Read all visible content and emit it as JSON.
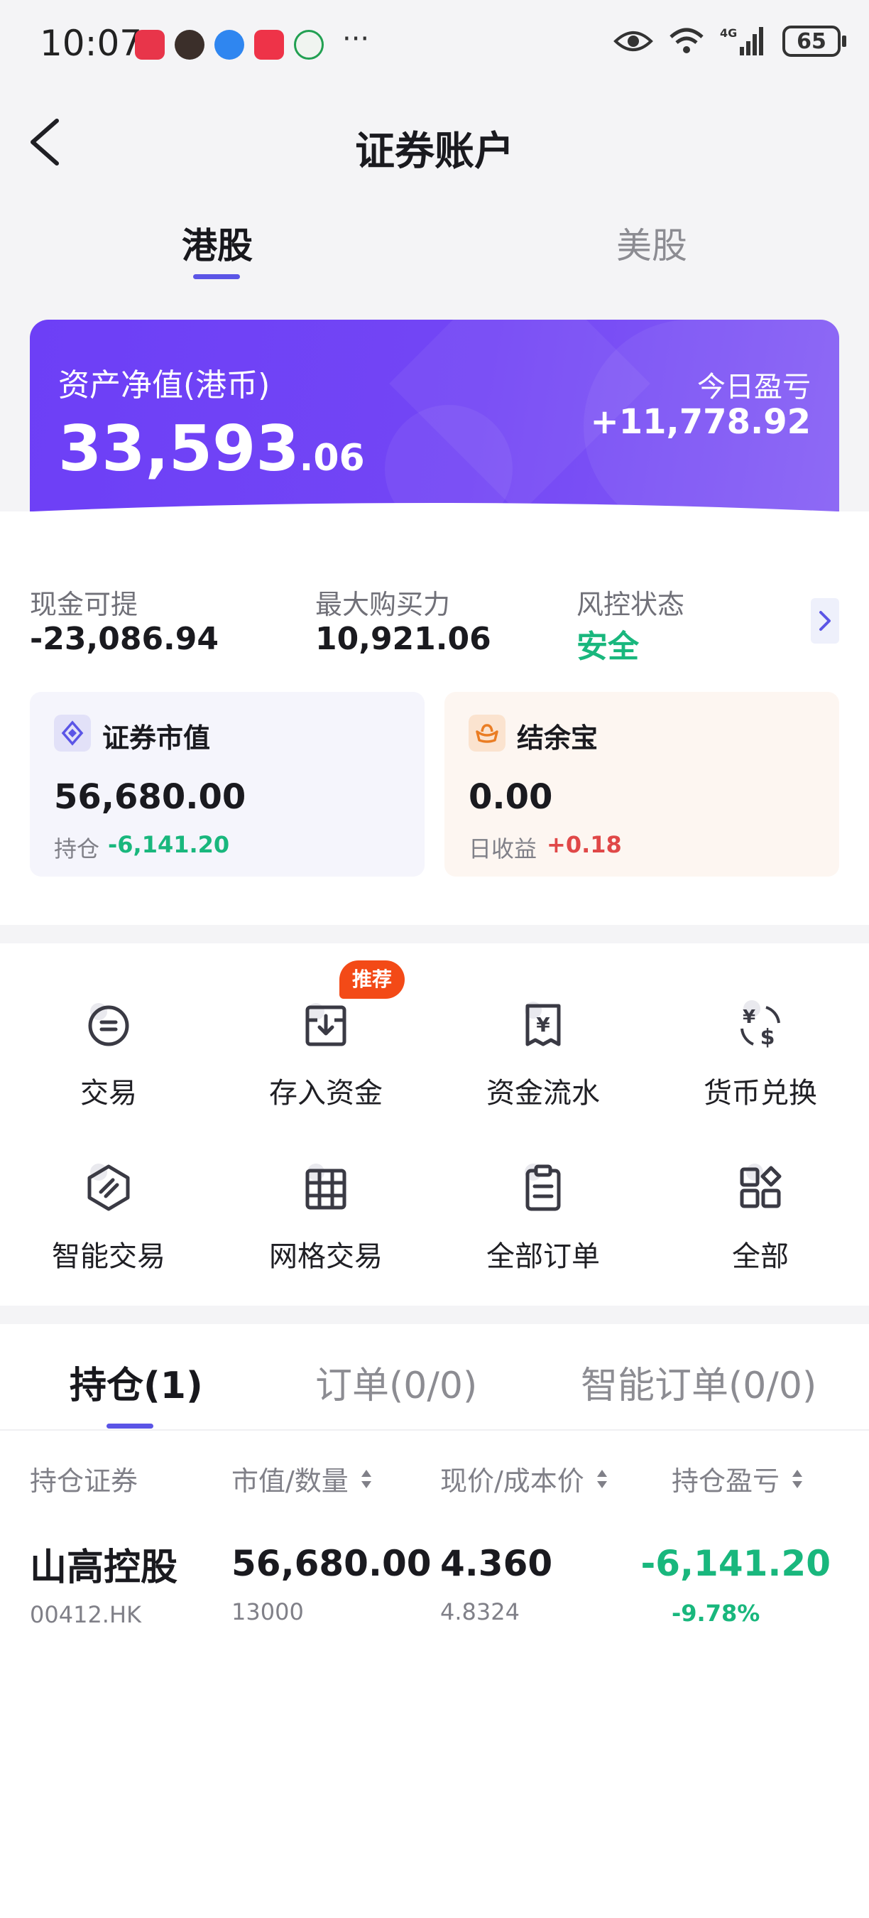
{
  "status_bar": {
    "time": "10:07",
    "more": "···",
    "battery": "65",
    "network": "4G"
  },
  "header": {
    "title": "证券账户"
  },
  "market_tabs": [
    {
      "label": "港股",
      "active": true
    },
    {
      "label": "美股",
      "active": false
    }
  ],
  "asset": {
    "label": "资产净值(港币)",
    "value_int": "33,593",
    "value_dec": ".06",
    "today_label": "今日盈亏",
    "today_value": "+11,778.92"
  },
  "summary": [
    {
      "label": "现金可提",
      "value": "-23,086.94"
    },
    {
      "label": "最大购买力",
      "value": "10,921.06"
    },
    {
      "label": "风控状态",
      "value": "安全"
    }
  ],
  "securities_card": {
    "title": "证券市值",
    "value": "56,680.00",
    "foot_label": "持仓",
    "foot_value": "-6,141.20"
  },
  "jieyubao_card": {
    "title": "结余宝",
    "value": "0.00",
    "foot_label": "日收益",
    "foot_value": "+0.18"
  },
  "actions": [
    {
      "label": "交易",
      "icon": "trade-icon"
    },
    {
      "label": "存入资金",
      "icon": "deposit-icon",
      "badge": "推荐"
    },
    {
      "label": "资金流水",
      "icon": "cash-flow-icon"
    },
    {
      "label": "货币兑换",
      "icon": "currency-exchange-icon"
    },
    {
      "label": "智能交易",
      "icon": "smart-trade-icon"
    },
    {
      "label": "网格交易",
      "icon": "grid-trade-icon"
    },
    {
      "label": "全部订单",
      "icon": "orders-icon"
    },
    {
      "label": "全部",
      "icon": "all-apps-icon"
    }
  ],
  "holdings_tabs": [
    {
      "label": "持仓(1)",
      "active": true
    },
    {
      "label": "订单(0/0)",
      "active": false
    },
    {
      "label": "智能订单(0/0)",
      "active": false
    }
  ],
  "columns": [
    "持仓证券",
    "市值/数量",
    "现价/成本价",
    "持仓盈亏"
  ],
  "holdings": [
    {
      "name": "山高控股",
      "code": "00412.HK",
      "market_value": "56,680.00",
      "quantity": "13000",
      "price": "4.360",
      "cost": "4.8324",
      "pl": "-6,141.20",
      "pl_pct": "-9.78%"
    }
  ],
  "colors": {
    "accent": "#5b55e6",
    "card_gradient_start": "#6d3ff6",
    "positive_green": "#19b77d",
    "negative_red": "#e04848",
    "badge": "#f34a17"
  }
}
